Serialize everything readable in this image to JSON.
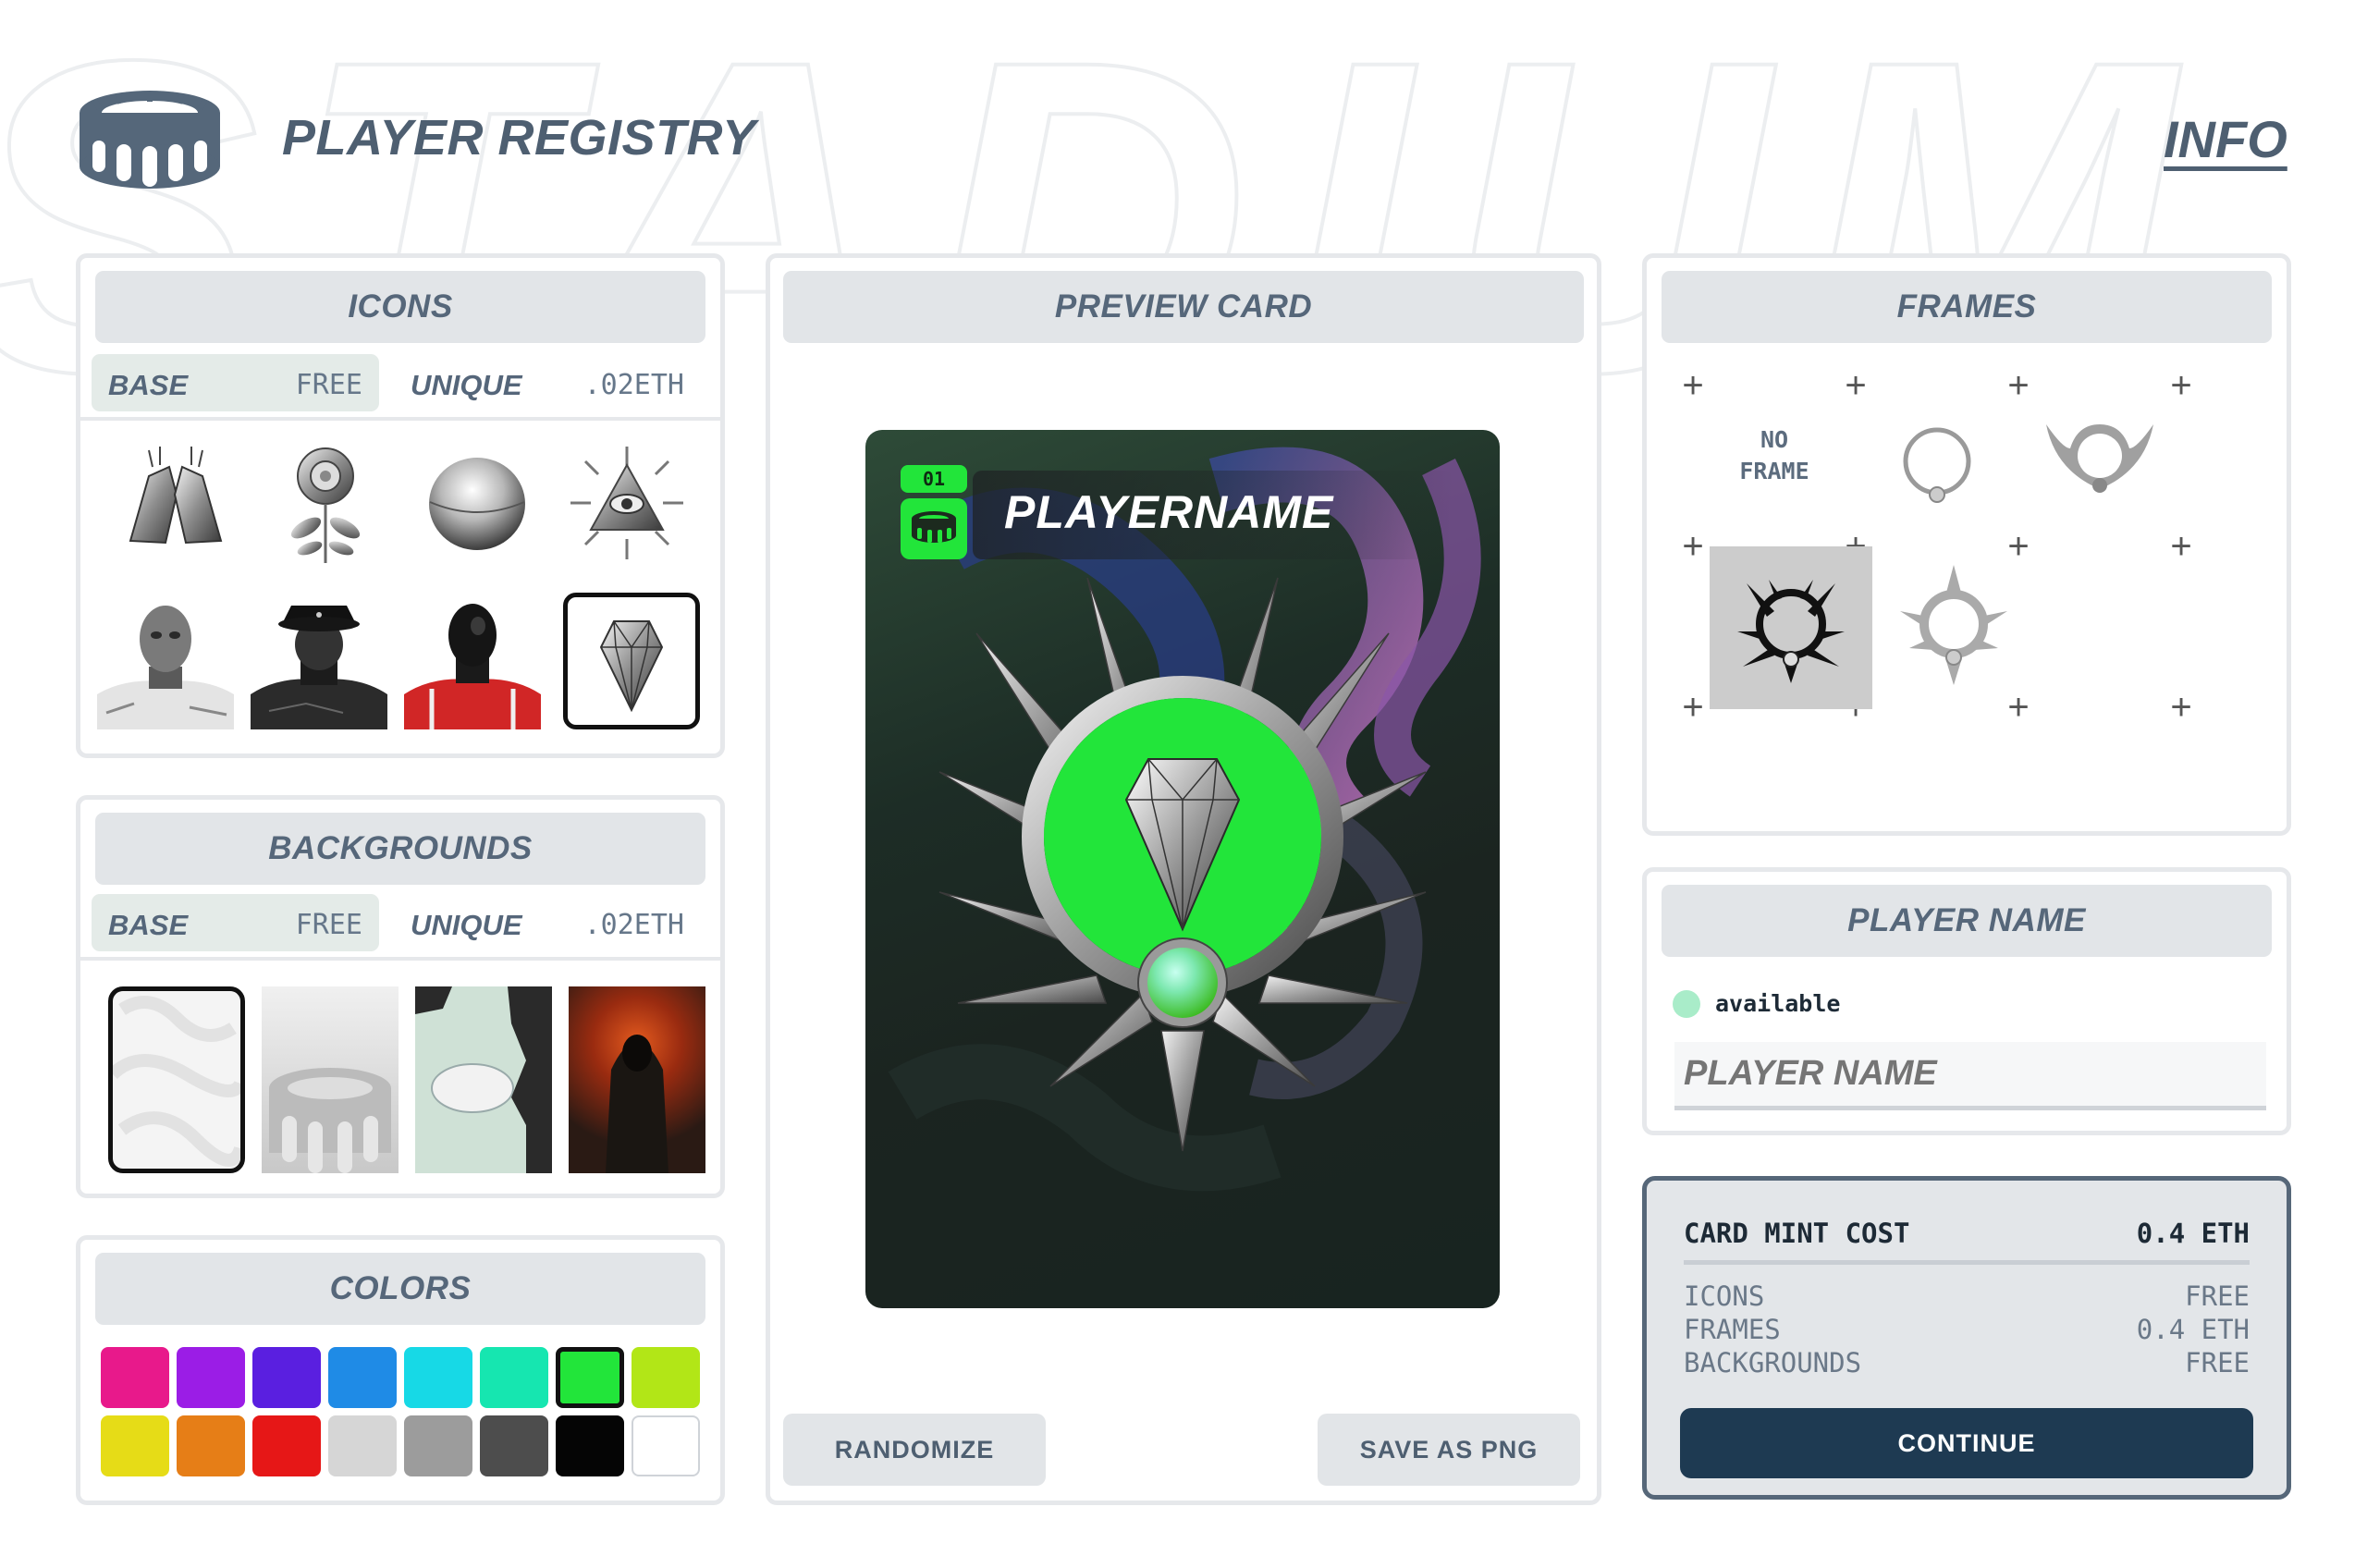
{
  "app": {
    "title": "PLAYER REGISTRY",
    "info_link": "INFO",
    "watermark_text": "STADIUM"
  },
  "icons_panel": {
    "header": "ICONS",
    "tabs": [
      {
        "label": "BASE",
        "price": "FREE",
        "active": true
      },
      {
        "label": "UNIQUE",
        "price": ".02ETH",
        "active": false
      }
    ],
    "items": [
      {
        "icon": "crossed-hands-icon"
      },
      {
        "icon": "rose-icon"
      },
      {
        "icon": "chrome-sphere-icon"
      },
      {
        "icon": "eye-pyramid-icon"
      },
      {
        "icon": "masked-figure-icon"
      },
      {
        "icon": "bucket-hat-figure-icon"
      },
      {
        "icon": "red-jersey-figure-icon"
      },
      {
        "icon": "diamond-gem-icon",
        "selected": true
      }
    ]
  },
  "backgrounds_panel": {
    "header": "BACKGROUNDS",
    "tabs": [
      {
        "label": "BASE",
        "price": "FREE",
        "active": true
      },
      {
        "label": "UNIQUE",
        "price": ".02ETH",
        "active": false
      }
    ],
    "items": [
      {
        "name": "white-pattern",
        "selected": true
      },
      {
        "name": "gray-stadium"
      },
      {
        "name": "mint-stadium-lettering"
      },
      {
        "name": "hooded-figure-red"
      }
    ]
  },
  "colors_panel": {
    "header": "COLORS",
    "swatches": [
      "#e8198b",
      "#9b1de6",
      "#5a1fe0",
      "#1f8be6",
      "#17d9e6",
      "#16e6b0",
      "#22e53a",
      "#b2e617",
      "#e6dc17",
      "#e67e17",
      "#e61717",
      "#d6d6d6",
      "#9c9c9c",
      "#4d4d4d",
      "#050505",
      "#ffffff"
    ],
    "selected_index": 6
  },
  "preview_panel": {
    "header": "PREVIEW CARD",
    "card": {
      "number": "01",
      "player_name": "PLAYERNAME",
      "accent_color": "#22e53a"
    },
    "randomize_label": "RANDOMIZE",
    "save_label": "SAVE AS PNG"
  },
  "frames_panel": {
    "header": "FRAMES",
    "no_frame_label": "NO\nFRAME",
    "items": [
      {
        "name": "no-frame"
      },
      {
        "name": "ring-frame"
      },
      {
        "name": "wing-frame"
      },
      {
        "name": "thorn-frame",
        "selected": true
      },
      {
        "name": "spiked-frame"
      }
    ]
  },
  "player_name_panel": {
    "header": "PLAYER NAME",
    "status": "available",
    "status_color": "#a9ecc9",
    "input_placeholder": "PLAYER NAME"
  },
  "cost_panel": {
    "title": "CARD MINT COST",
    "total": "0.4 ETH",
    "rows": [
      {
        "label": "ICONS",
        "value": "FREE"
      },
      {
        "label": "FRAMES",
        "value": "0.4 ETH"
      },
      {
        "label": "BACKGROUNDS",
        "value": "FREE"
      }
    ],
    "continue_label": "CONTINUE"
  }
}
